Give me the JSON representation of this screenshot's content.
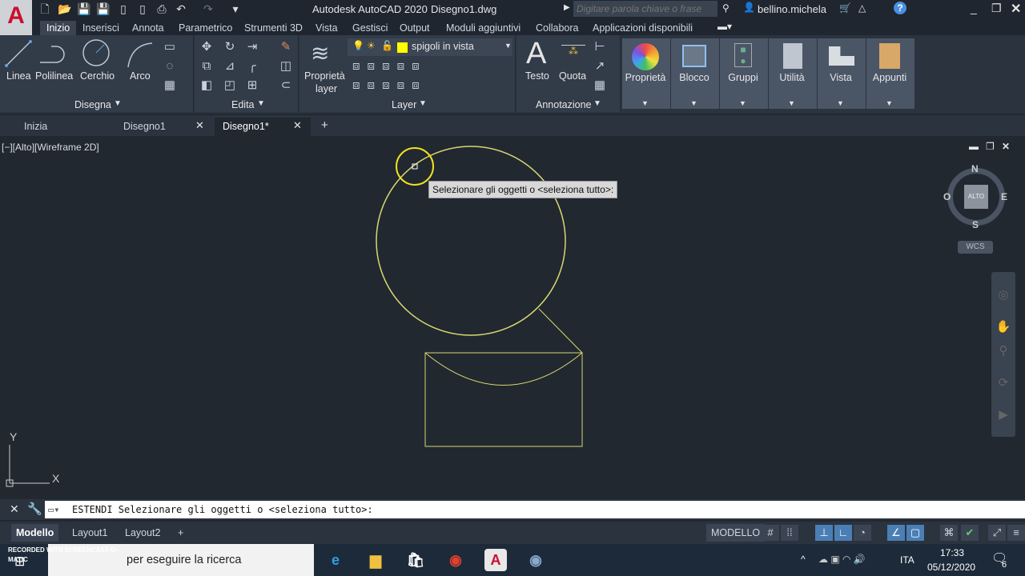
{
  "title": {
    "app": "Autodesk AutoCAD 2020",
    "file": "Disegno1.dwg",
    "search_placeholder": "Digitare parola chiave o frase",
    "user": "bellino.michela"
  },
  "menu_tabs": [
    "Inizio",
    "Inserisci",
    "Annota",
    "Parametrico",
    "Strumenti 3D",
    "Vista",
    "Gestisci",
    "Output",
    "Moduli aggiuntivi",
    "Collabora",
    "Applicazioni disponibili"
  ],
  "ribbon": {
    "draw": {
      "linea": "Linea",
      "polilinea": "Polilinea",
      "cerchio": "Cerchio",
      "arco": "Arco",
      "panel": "Disegna"
    },
    "edit": {
      "panel": "Edita"
    },
    "layer": {
      "props": "Proprietà",
      "props2": "layer",
      "current": "spigoli in vista",
      "panel": "Layer",
      "current_color": "#ffff00"
    },
    "annot": {
      "testo": "Testo",
      "quota": "Quota",
      "panel": "Annotazione"
    },
    "big": [
      "Proprietà",
      "Blocco",
      "Gruppi",
      "Utilità",
      "Vista",
      "Appunti"
    ]
  },
  "doc_tabs": [
    "Inizia",
    "Disegno1",
    "Disegno1*"
  ],
  "viewport": {
    "label": "[−][Alto][Wireframe 2D]",
    "tooltip": "Selezionare gli oggetti o <seleziona tutto>:",
    "viewcube": {
      "n": "N",
      "s": "S",
      "e": "E",
      "w": "O",
      "center": "ALTO",
      "wcs": "WCS"
    },
    "ucs_x": "X",
    "ucs_y": "Y"
  },
  "command": {
    "text": "ESTENDI Selezionare gli oggetti o <seleziona tutto>:"
  },
  "layout_tabs": [
    "Modello",
    "Layout1",
    "Layout2"
  ],
  "status": {
    "mode": "MODELLO"
  },
  "taskbar": {
    "search": "per eseguire la ricerca",
    "lang": "ITA",
    "time": "17:33",
    "date": "05/12/2020",
    "notifications": "6",
    "watermark": "RECORDED WITH SCREENCAST-O-MATIC"
  }
}
